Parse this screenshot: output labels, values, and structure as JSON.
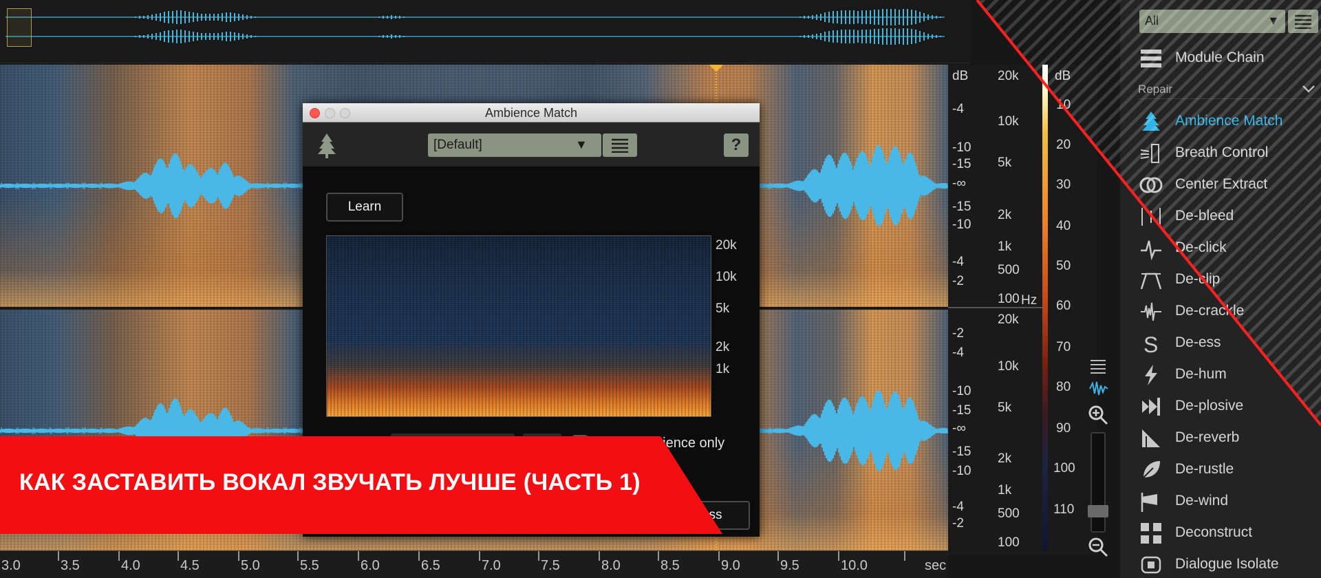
{
  "dialog": {
    "title": "Ambience Match",
    "preset": "[Default]",
    "help_label": "?",
    "learn_label": "Learn",
    "ambience_only_label": "bience only",
    "process_label": "cess",
    "freq_labels": [
      "20k",
      "10k",
      "5k",
      "2k",
      "1k"
    ]
  },
  "db_scale_labels": {
    "header": "dB",
    "top": [
      "-4",
      "-10",
      "-15",
      "-∞",
      "-15",
      "-10",
      "-4",
      "-2"
    ],
    "bottom": [
      "-2",
      "-4",
      "-10",
      "-15",
      "-∞",
      "-15",
      "-10",
      "-4",
      "-2"
    ]
  },
  "hz_scale_labels": {
    "top": [
      "20k",
      "10k",
      "5k",
      "2k",
      "1k",
      "500",
      "100"
    ],
    "unit": "Hz",
    "bottom": [
      "20k",
      "10k",
      "5k",
      "2k",
      "1k",
      "500",
      "100"
    ]
  },
  "meter_scale": {
    "header": "dB",
    "values": [
      "10",
      "20",
      "30",
      "40",
      "50",
      "60",
      "70",
      "80",
      "90",
      "100",
      "110"
    ]
  },
  "time_ruler": {
    "labels": [
      "3.0",
      "3.5",
      "4.0",
      "4.5",
      "5.0",
      "5.5",
      "6.0",
      "6.5",
      "7.0",
      "7.5",
      "8.0",
      "8.5",
      "9.0",
      "9.5",
      "10.0"
    ],
    "unit": "sec"
  },
  "right_panel": {
    "filter_value": "All",
    "module_chain_label": "Module Chain",
    "section_label": "Repair",
    "modules": [
      {
        "label": "Ambience Match",
        "icon": "tree-icon"
      },
      {
        "label": "Breath Control",
        "icon": "breath-icon"
      },
      {
        "label": "Center Extract",
        "icon": "center-extract-icon"
      },
      {
        "label": "De-bleed",
        "icon": "de-bleed-icon"
      },
      {
        "label": "De-click",
        "icon": "de-click-icon"
      },
      {
        "label": "De-clip",
        "icon": "de-clip-icon"
      },
      {
        "label": "De-crackle",
        "icon": "de-crackle-icon"
      },
      {
        "label": "De-ess",
        "icon": "de-ess-icon"
      },
      {
        "label": "De-hum",
        "icon": "de-hum-icon"
      },
      {
        "label": "De-plosive",
        "icon": "de-plosive-icon"
      },
      {
        "label": "De-reverb",
        "icon": "de-reverb-icon"
      },
      {
        "label": "De-rustle",
        "icon": "de-rustle-icon"
      },
      {
        "label": "De-wind",
        "icon": "de-wind-icon"
      },
      {
        "label": "Deconstruct",
        "icon": "deconstruct-icon"
      },
      {
        "label": "Dialogue Isolate",
        "icon": "dialogue-isolate-icon"
      }
    ],
    "active_color": "#2fb4e8"
  },
  "banner": {
    "text": "КАК ЗАСТАВИТЬ ВОКАЛ ЗВУЧАТЬ ЛУЧШЕ (ЧАСТЬ 1)",
    "color": "#f20f14"
  }
}
